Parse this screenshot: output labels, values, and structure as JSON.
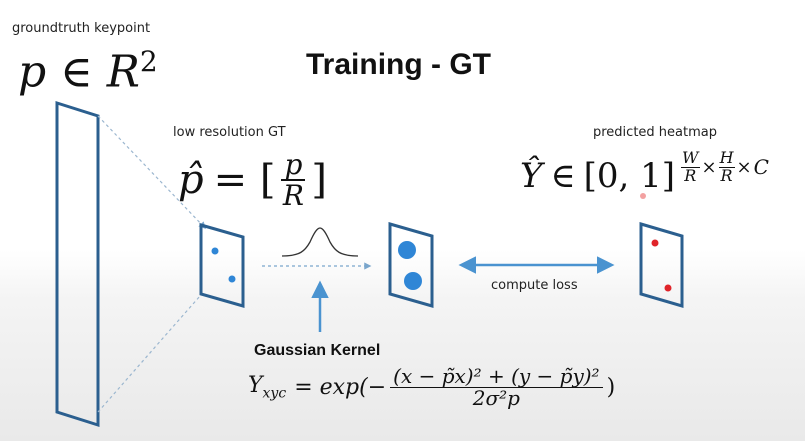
{
  "title": "Training - GT",
  "groundtruth": {
    "label": "groundtruth keypoint",
    "formula": {
      "var": "p",
      "in": "∈",
      "space": "R",
      "exp": "2"
    }
  },
  "lowres": {
    "label": "low resolution GT",
    "formula": {
      "hat_var": "p̂",
      "eq": "= [",
      "num": "p",
      "den": "R",
      "close": "]"
    }
  },
  "predicted": {
    "label": "predicted heatmap",
    "formula": {
      "hat_var": "Ŷ",
      "in": "∈",
      "interval": "[0, 1]",
      "w_num": "W",
      "w_den": "R",
      "times1": "×",
      "h_num": "H",
      "h_den": "R",
      "times2": "×",
      "c": "C"
    }
  },
  "compute_loss": {
    "label": "compute loss"
  },
  "gaussian_kernel": {
    "label": "Gaussian Kernel",
    "formula": {
      "lhs": "Y",
      "lhs_sub": "xyc",
      "rhs_start": "= exp(−",
      "numerator": "(x − p̃x)² + (y − p̃y)²",
      "denominator": "2σ²p",
      "rhs_end": ")"
    }
  },
  "colors": {
    "shape_stroke": "#2b5f8f",
    "blue_dot": "#2f86d6",
    "red_dot": "#e0242a",
    "arrow": "#4a93d0"
  }
}
